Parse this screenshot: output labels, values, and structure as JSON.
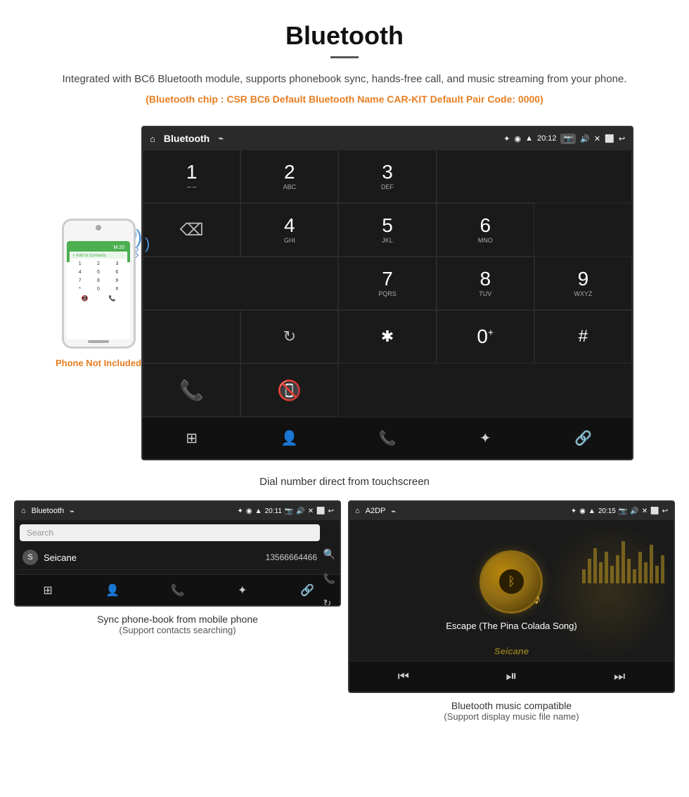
{
  "header": {
    "title": "Bluetooth",
    "description": "Integrated with BC6 Bluetooth module, supports phonebook sync, hands-free call, and music streaming from your phone.",
    "specs": "(Bluetooth chip : CSR BC6   Default Bluetooth Name CAR-KIT    Default Pair Code: 0000)"
  },
  "phone_mockup": {
    "not_included_label": "Phone Not Included",
    "screen_header": "M:20",
    "add_contact": "Add to Contacts",
    "keypad": [
      "1",
      "2",
      "3",
      "4",
      "5",
      "6",
      "7",
      "8",
      "9",
      "*",
      "0",
      "#"
    ]
  },
  "dial_screen": {
    "topbar": {
      "home_icon": "⌂",
      "title": "Bluetooth",
      "usb_icon": "⌁",
      "bt_icon": "✦",
      "location_icon": "◉",
      "signal_icon": "▲",
      "time": "20:12",
      "camera_label": "📷",
      "volume_icon": "🔊",
      "close_icon": "✕",
      "window_icon": "⬜",
      "back_icon": "↩"
    },
    "keys": [
      {
        "num": "1",
        "sub": "∽∽"
      },
      {
        "num": "2",
        "sub": "ABC"
      },
      {
        "num": "3",
        "sub": "DEF"
      },
      {
        "num": "4",
        "sub": "GHI"
      },
      {
        "num": "5",
        "sub": "JKL"
      },
      {
        "num": "6",
        "sub": "MNO"
      },
      {
        "num": "7",
        "sub": "PQRS"
      },
      {
        "num": "8",
        "sub": "TUV"
      },
      {
        "num": "9",
        "sub": "WXYZ"
      },
      {
        "num": "*",
        "sub": ""
      },
      {
        "num": "0",
        "sub": "+"
      },
      {
        "num": "#",
        "sub": ""
      }
    ],
    "bottom_icons": [
      "⊞",
      "👤",
      "📞",
      "✦",
      "🔗"
    ],
    "caption": "Dial number direct from touchscreen"
  },
  "phonebook_panel": {
    "topbar_title": "Bluetooth",
    "topbar_icon": "⌁",
    "time": "20:11",
    "search_placeholder": "Search",
    "contacts": [
      {
        "initial": "S",
        "name": "Seicane",
        "number": "13566664466"
      }
    ],
    "right_icons": [
      "🔍",
      "📞",
      "🔄"
    ],
    "bottom_icons": [
      "⊞",
      "👤",
      "📞",
      "✦",
      "🔗"
    ],
    "caption": "Sync phone-book from mobile phone",
    "caption_sub": "(Support contacts searching)"
  },
  "music_panel": {
    "topbar_title": "A2DP",
    "topbar_icon": "⌁",
    "time": "20:15",
    "song_title": "Escape (The Pina Colada Song)",
    "bottom_icons": [
      "⏮",
      "⏯",
      "⏭"
    ],
    "caption": "Bluetooth music compatible",
    "caption_sub": "(Support display music file name)"
  },
  "watermark": "Seicane"
}
